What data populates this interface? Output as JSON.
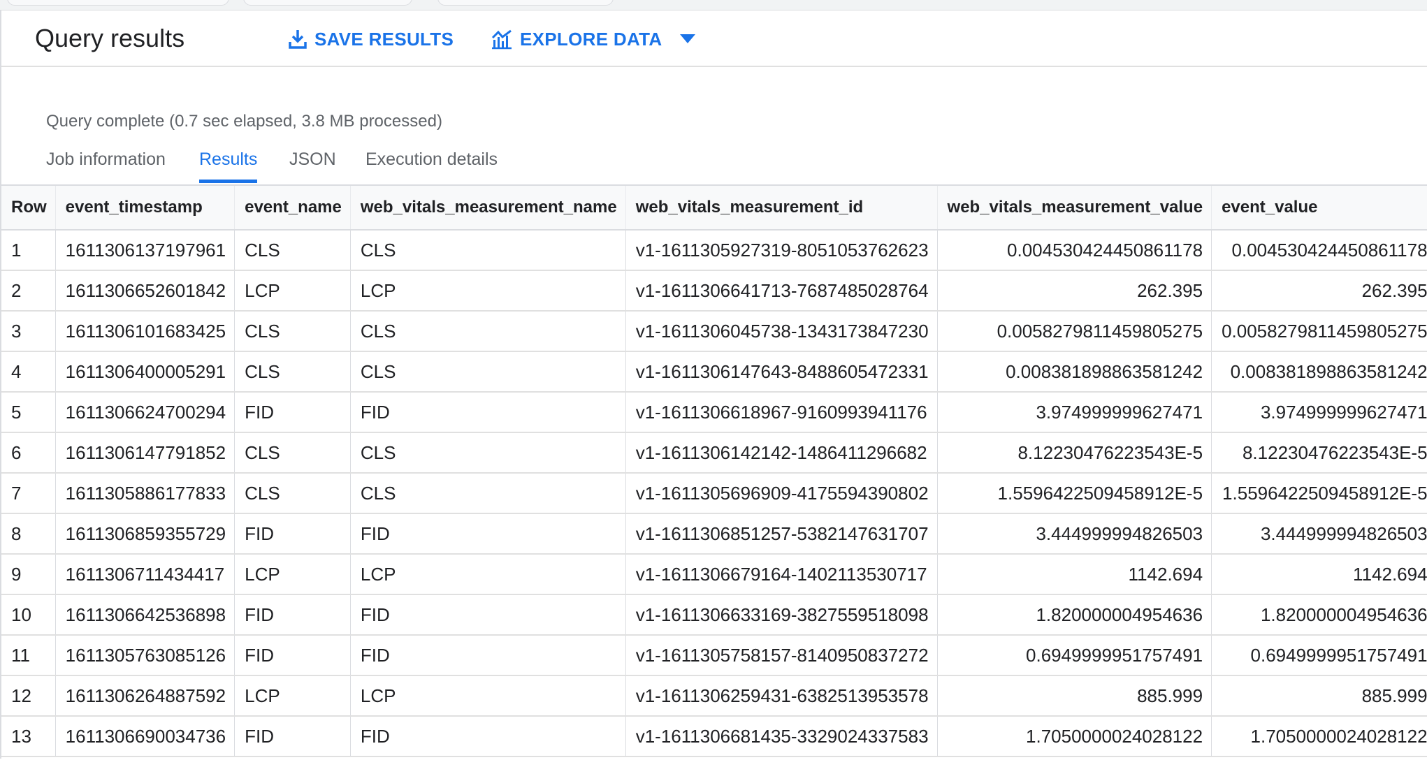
{
  "header": {
    "title": "Query results",
    "save_label": "SAVE RESULTS",
    "explore_label": "EXPLORE DATA"
  },
  "status_text": "Query complete (0.7 sec elapsed, 3.8 MB processed)",
  "tabs": [
    "Job information",
    "Results",
    "JSON",
    "Execution details"
  ],
  "active_tab": "Results",
  "colors": {
    "accent": "#1a73e8",
    "text": "#202124",
    "muted": "#5f6368"
  },
  "table": {
    "columns": [
      "Row",
      "event_timestamp",
      "event_name",
      "web_vitals_measurement_name",
      "web_vitals_measurement_id",
      "web_vitals_measurement_value",
      "event_value"
    ],
    "rows": [
      [
        "1",
        "1611306137197961",
        "CLS",
        "CLS",
        "v1-1611305927319-8051053762623",
        "0.004530424450861178",
        "0.004530424450861178"
      ],
      [
        "2",
        "1611306652601842",
        "LCP",
        "LCP",
        "v1-1611306641713-7687485028764",
        "262.395",
        "262.395"
      ],
      [
        "3",
        "1611306101683425",
        "CLS",
        "CLS",
        "v1-1611306045738-1343173847230",
        "0.0058279811459805275",
        "0.0058279811459805275"
      ],
      [
        "4",
        "1611306400005291",
        "CLS",
        "CLS",
        "v1-1611306147643-8488605472331",
        "0.008381898863581242",
        "0.008381898863581242"
      ],
      [
        "5",
        "1611306624700294",
        "FID",
        "FID",
        "v1-1611306618967-9160993941176",
        "3.974999999627471",
        "3.974999999627471"
      ],
      [
        "6",
        "1611306147791852",
        "CLS",
        "CLS",
        "v1-1611306142142-1486411296682",
        "8.12230476223543E-5",
        "8.12230476223543E-5"
      ],
      [
        "7",
        "1611305886177833",
        "CLS",
        "CLS",
        "v1-1611305696909-4175594390802",
        "1.5596422509458912E-5",
        "1.5596422509458912E-5"
      ],
      [
        "8",
        "1611306859355729",
        "FID",
        "FID",
        "v1-1611306851257-5382147631707",
        "3.444999994826503",
        "3.444999994826503"
      ],
      [
        "9",
        "1611306711434417",
        "LCP",
        "LCP",
        "v1-1611306679164-1402113530717",
        "1142.694",
        "1142.694"
      ],
      [
        "10",
        "1611306642536898",
        "FID",
        "FID",
        "v1-1611306633169-3827559518098",
        "1.820000004954636",
        "1.820000004954636"
      ],
      [
        "11",
        "1611305763085126",
        "FID",
        "FID",
        "v1-1611305758157-8140950837272",
        "0.6949999951757491",
        "0.6949999951757491"
      ],
      [
        "12",
        "1611306264887592",
        "LCP",
        "LCP",
        "v1-1611306259431-6382513953578",
        "885.999",
        "885.999"
      ],
      [
        "13",
        "1611306690034736",
        "FID",
        "FID",
        "v1-1611306681435-3329024337583",
        "1.7050000024028122",
        "1.7050000024028122"
      ]
    ]
  }
}
